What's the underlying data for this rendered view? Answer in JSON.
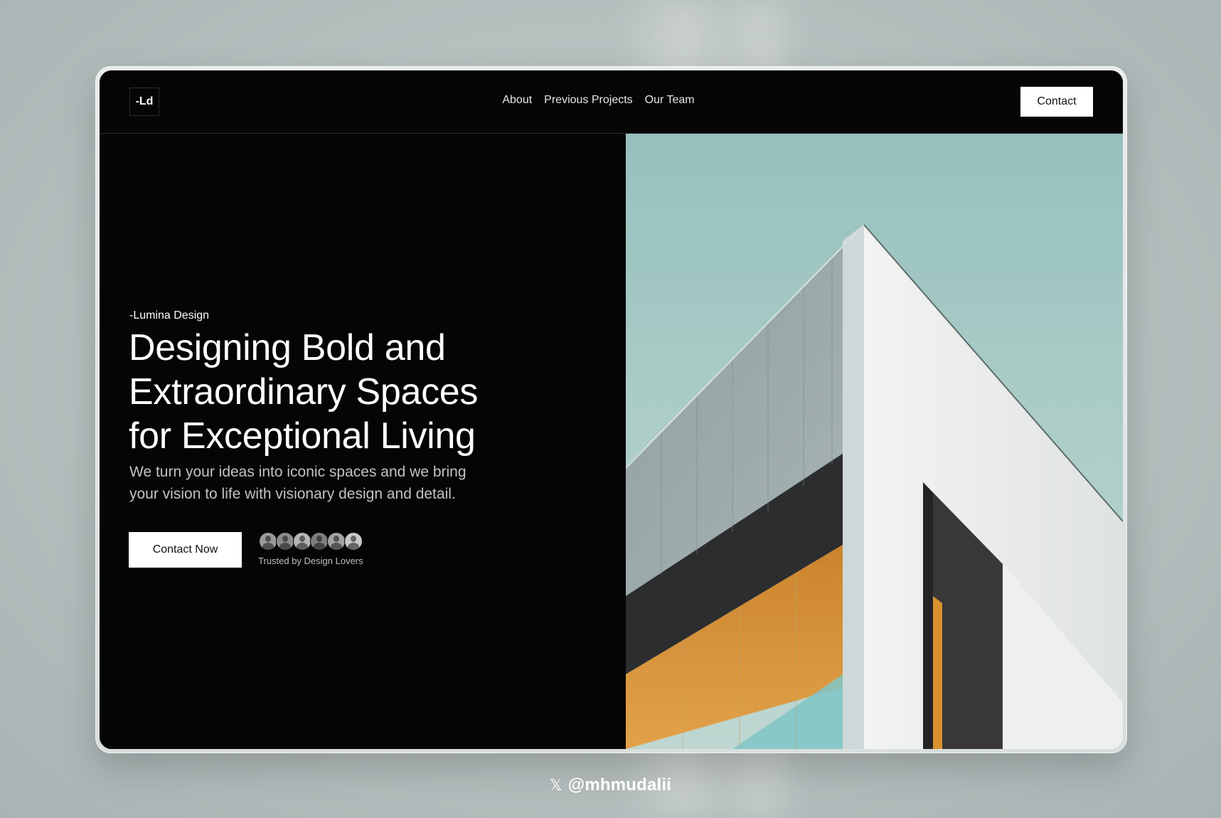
{
  "nav": {
    "logo": "-Ld",
    "links": [
      "About",
      "Previous Projects",
      "Our Team"
    ],
    "contact_label": "Contact"
  },
  "hero": {
    "eyebrow": "-Lumina Design",
    "headline": "Designing Bold and Extraordinary Spaces for Exceptional Living",
    "subtext": "We turn your ideas into iconic spaces and we bring your vision to life with visionary design and detail.",
    "cta_label": "Contact Now",
    "trusted_label": "Trusted by Design Lovers",
    "avatar_count": 6
  },
  "footer": {
    "x_icon": "𝕏",
    "handle": "@mhmudalii"
  },
  "colors": {
    "background": "#b9c2c1",
    "screen": "#050505",
    "sky": "#a9cbc6",
    "accent_orange": "#d9922f",
    "button": "#ffffff"
  }
}
